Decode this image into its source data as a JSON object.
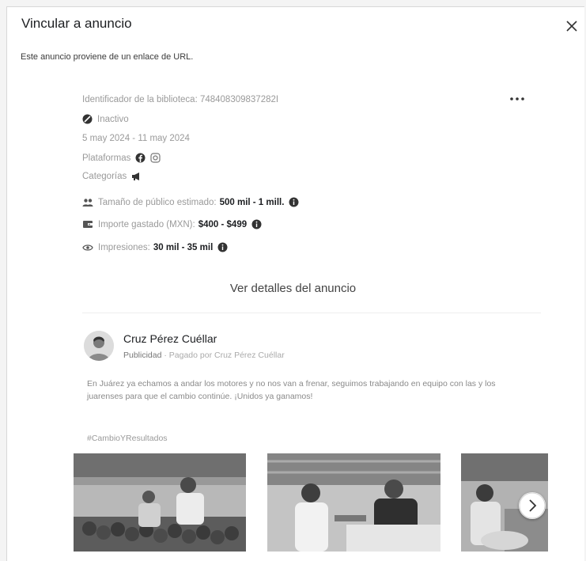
{
  "dialog": {
    "title": "Vincular a anuncio",
    "subtitle": "Este anuncio proviene de un enlace de URL."
  },
  "ad": {
    "library_id": "Identificador de la biblioteca: 748408309837282I",
    "status": "Inactivo",
    "date_range": "5 may 2024 - 11 may 2024",
    "platforms_label": "Plataformas",
    "platform_icons": [
      "facebook-icon",
      "instagram-icon"
    ],
    "categories_label": "Categorías",
    "category_icon": "megaphone-icon",
    "audience_label": "Tamaño de público estimado:",
    "audience_value": "500 mil - 1 mill.",
    "spend_label": "Importe gastado (MXN):",
    "spend_value": "$400 - $499",
    "impressions_label": "Impresiones:",
    "impressions_value": "30 mil - 35 mil",
    "view_details": "Ver detalles del anuncio"
  },
  "post": {
    "author": "Cruz Pérez Cuéllar",
    "sponsored": "Publicidad",
    "paid_by": "· Pagado por Cruz Pérez Cuéllar",
    "text": "En Juárez ya echamos a andar los motores y no nos van a frenar, seguimos trabajando en equipo con las y los juarenses para que el cambio continúe. ¡Unidos ya ganamos!",
    "hashtag": "#CambioYResultados"
  },
  "colors": {
    "accent": "#1c1e21",
    "muted": "#9a9a9a",
    "background": "#ffffff"
  }
}
